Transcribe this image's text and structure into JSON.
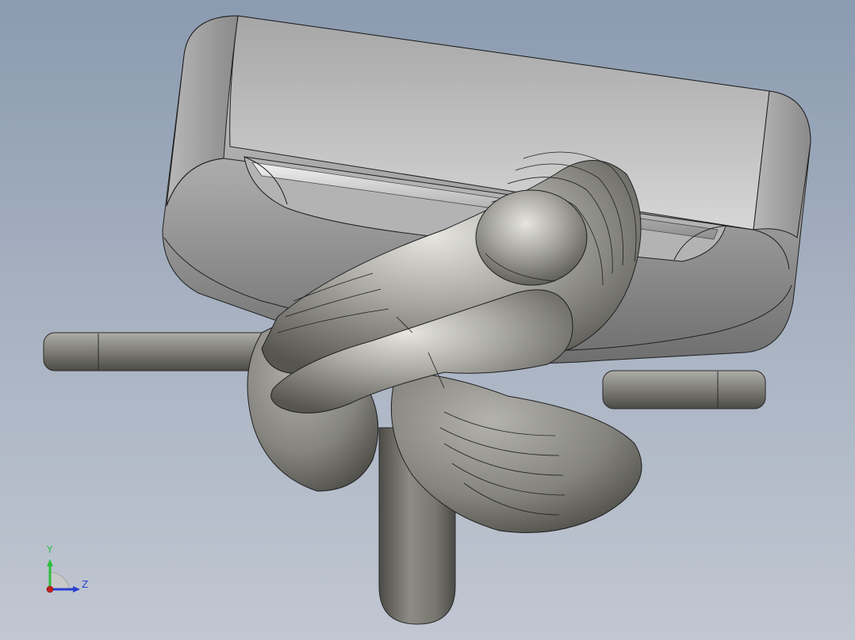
{
  "graphics_area": {
    "background_top": "#8b9bb0",
    "background_bottom": "#c1c7d2"
  },
  "model": {
    "body_color": "#a9a8a3",
    "shadow_color": "#57554f",
    "edge_color": "#1f1f1f",
    "parts": [
      "base-block",
      "slot",
      "bent-rod",
      "left-rod",
      "right-rod",
      "lower-leg",
      "twisted-knot"
    ]
  },
  "triad": {
    "y_label": "Y",
    "z_label": "Z",
    "y_color": "#2bbf3a",
    "z_color": "#2a3fd0",
    "origin_color": "#c0201c"
  }
}
